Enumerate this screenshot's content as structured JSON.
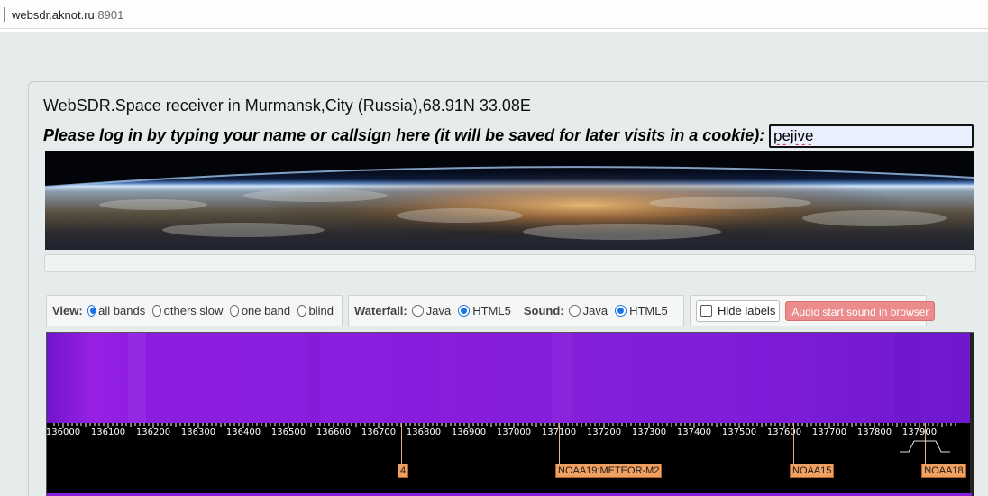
{
  "browser": {
    "url_host": "websdr.aknot.ru",
    "url_port": ":8901"
  },
  "header": {
    "title": "WebSDR.Space receiver in Murmansk,City (Russia),68.91N 33.08E",
    "login_prompt": "Please log in by typing your name or callsign here (it will be saved for later visits in a cookie):",
    "login_value": "pejive"
  },
  "view": {
    "label": "View:",
    "options": [
      "all bands",
      "others slow",
      "one band",
      "blind"
    ],
    "selected": "all bands"
  },
  "waterfall_opts": {
    "label": "Waterfall:",
    "options": [
      "Java",
      "HTML5"
    ],
    "selected": "HTML5"
  },
  "sound_opts": {
    "label": "Sound:",
    "options": [
      "Java",
      "HTML5"
    ],
    "selected": "HTML5"
  },
  "labels_toggle": {
    "label": "Hide labels",
    "checked": false
  },
  "audio_button": "Audio start sound in browser",
  "frequency_scale": {
    "ticks": [
      "136000",
      "136100",
      "136200",
      "136300",
      "136400",
      "136500",
      "136600",
      "136700",
      "136800",
      "136900",
      "137000",
      "137100",
      "137200",
      "137300",
      "137400",
      "137500",
      "137600",
      "137700",
      "137800",
      "137900"
    ]
  },
  "station_labels": [
    {
      "text": "4",
      "freq_khz": 136750
    },
    {
      "text": "NOAA19:METEOR-M2",
      "freq_khz": 137100
    },
    {
      "text": "NOAA15",
      "freq_khz": 137620
    },
    {
      "text": "NOAA18",
      "freq_khz": 137912.5
    }
  ],
  "colors": {
    "waterfall": "#8a1edd",
    "tag_bg": "#f0a060",
    "audio_button": "#ec8b8b",
    "java_text": "#c0271f",
    "html5_text": "#2a7a1a"
  }
}
